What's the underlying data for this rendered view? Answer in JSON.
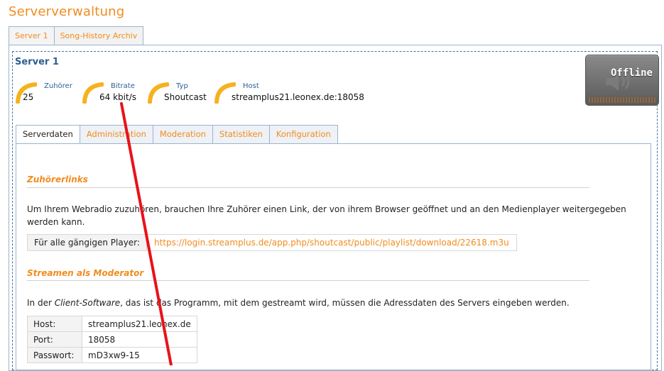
{
  "page": {
    "title": "Serververwaltung"
  },
  "top_tabs": [
    {
      "label": "Server 1",
      "active": true
    },
    {
      "label": "Song-History Archiv",
      "active": false
    }
  ],
  "server": {
    "heading": "Server 1",
    "stats": [
      {
        "label": "Zuhörer",
        "value": "25"
      },
      {
        "label": "Bitrate",
        "value": "64 kbit/s"
      },
      {
        "label": "Typ",
        "value": "Shoutcast"
      },
      {
        "label": "Host",
        "value": "streamplus21.leonex.de:18058"
      }
    ],
    "status": "Offline"
  },
  "sub_tabs": [
    {
      "label": "Serverdaten",
      "active": true
    },
    {
      "label": "Administration",
      "active": false
    },
    {
      "label": "Moderation",
      "active": false
    },
    {
      "label": "Statistiken",
      "active": false
    },
    {
      "label": "Konfiguration",
      "active": false
    }
  ],
  "listener_links": {
    "title": "Zuhörerlinks",
    "description": "Um Ihrem Webradio zuzuhören, brauchen Ihre Zuhörer einen Link, der von ihrem Browser geöffnet und an den Medienplayer weitergegeben werden kann.",
    "player_label": "Für alle gängigen Player:",
    "player_url": "https://login.streamplus.de/app.php/shoutcast/public/playlist/download/22618.m3u"
  },
  "moderator": {
    "title": "Streamen als Moderator",
    "description_pre": "In der ",
    "description_em": "Client-Software",
    "description_post": ", das ist das Programm, mit dem gestreamt wird, müssen die Adressdaten des Servers eingeben werden.",
    "rows": [
      {
        "key": "Host:",
        "value": "streamplus21.leonex.de"
      },
      {
        "key": "Port:",
        "value": "18058"
      },
      {
        "key": "Passwort:",
        "value": "mD3xw9-15"
      }
    ]
  },
  "colors": {
    "accent": "#f08c1e",
    "heading_blue": "#2e5e91",
    "annotation": "#e8121a"
  }
}
